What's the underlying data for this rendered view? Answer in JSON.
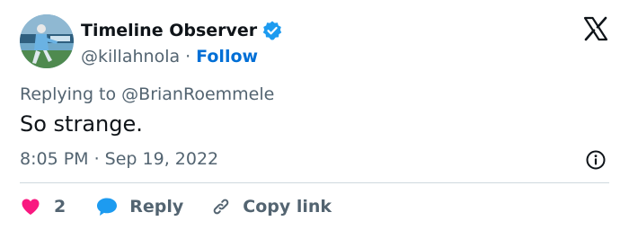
{
  "author": {
    "display_name": "Timeline Observer",
    "handle": "@killahnola",
    "follow_label": "Follow",
    "verified": true,
    "verified_color": "#1d9bf0"
  },
  "reply_context": "Replying to @BrianRoemmele",
  "body": "So strange.",
  "timestamp": "8:05 PM · Sep 19, 2022",
  "actions": {
    "like_count": "2",
    "reply_label": "Reply",
    "copy_label": "Copy link"
  },
  "icons": {
    "platform": "x-logo-icon",
    "info": "info-icon",
    "like": "heart-icon",
    "reply": "reply-bubble-icon",
    "copy": "link-icon"
  },
  "colors": {
    "like": "#f91880",
    "reply": "#1d9bf0",
    "follow": "#006fd6",
    "muted": "#536471"
  }
}
